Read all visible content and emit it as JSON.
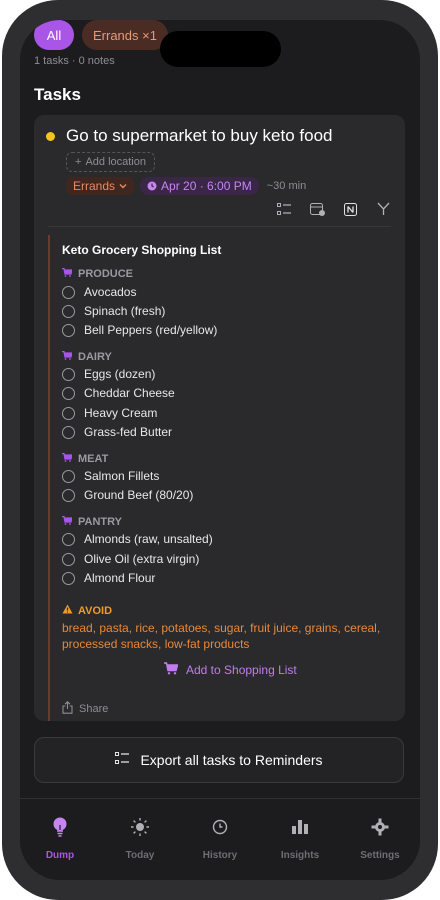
{
  "filters": {
    "all_label": "All",
    "errands_label": "Errands ×1"
  },
  "counts": "1 tasks · 0 notes",
  "section_title": "Tasks",
  "task": {
    "title": "Go to supermarket to buy keto food",
    "add_location": "Add location",
    "tag": "Errands",
    "date": "Apr 20 · 6:00 PM",
    "duration": "~30 min",
    "status_color": "#f5c518"
  },
  "notes": {
    "title": "Keto Grocery Shopping List",
    "groups": [
      {
        "name": "PRODUCE",
        "items": [
          "Avocados",
          "Spinach (fresh)",
          "Bell Peppers (red/yellow)"
        ]
      },
      {
        "name": "DAIRY",
        "items": [
          "Eggs (dozen)",
          "Cheddar Cheese",
          "Heavy Cream",
          "Grass-fed Butter"
        ]
      },
      {
        "name": "MEAT",
        "items": [
          "Salmon Fillets",
          "Ground Beef (80/20)"
        ]
      },
      {
        "name": "PANTRY",
        "items": [
          "Almonds (raw, unsalted)",
          "Olive Oil (extra virgin)",
          "Almond Flour"
        ]
      }
    ],
    "avoid_heading": "AVOID",
    "avoid_text": "bread, pasta, rice, potatoes, sugar, fruit juice, grains, cereal, processed snacks, low-fat products",
    "add_to_list": "Add to Shopping List",
    "share": "Share"
  },
  "export_label": "Export all tasks to Reminders",
  "tabs": [
    {
      "label": "Dump",
      "icon": "lightbulb-icon"
    },
    {
      "label": "Today",
      "icon": "sun-icon"
    },
    {
      "label": "History",
      "icon": "clock-icon"
    },
    {
      "label": "Insights",
      "icon": "bar-chart-icon"
    },
    {
      "label": "Settings",
      "icon": "gear-icon"
    }
  ],
  "colors": {
    "accent": "#a855e8",
    "avoid": "#f09a28",
    "errands": "#e58a63"
  }
}
